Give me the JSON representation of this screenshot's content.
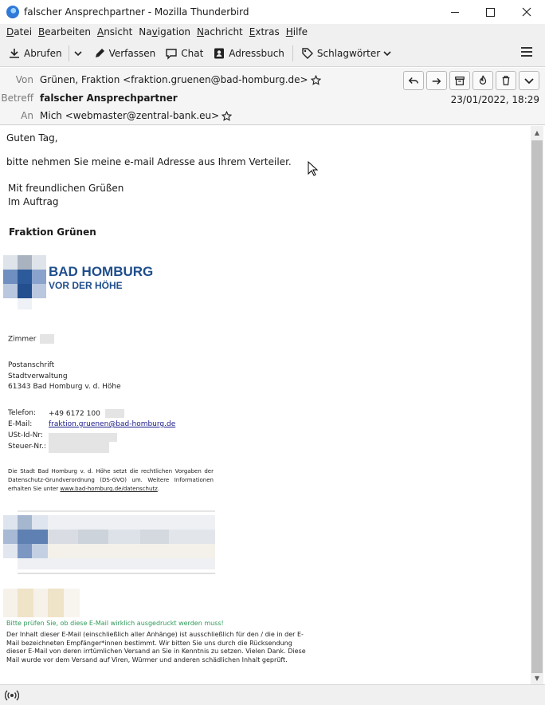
{
  "window": {
    "title": "falscher Ansprechpartner - Mozilla Thunderbird",
    "controls": [
      "minimize",
      "maximize",
      "close"
    ]
  },
  "menubar": {
    "items": [
      {
        "label": "Datei",
        "accel": "D"
      },
      {
        "label": "Bearbeiten",
        "accel": "B"
      },
      {
        "label": "Ansicht",
        "accel": "A"
      },
      {
        "label": "Navigation",
        "accel": "v"
      },
      {
        "label": "Nachricht",
        "accel": "N"
      },
      {
        "label": "Extras",
        "accel": "E"
      },
      {
        "label": "Hilfe",
        "accel": "H"
      }
    ]
  },
  "toolbar": {
    "abrufen": "Abrufen",
    "verfassen": "Verfassen",
    "chat": "Chat",
    "adressbuch": "Adressbuch",
    "schlagwoerter": "Schlagwörter"
  },
  "header": {
    "von_label": "Von",
    "von_value": "Grünen, Fraktion <fraktion.gruenen@bad-homburg.de>",
    "betreff_label": "Betreff",
    "betreff_value": "falscher Ansprechpartner",
    "an_label": "An",
    "an_value": "Mich <webmaster@zentral-bank.eu>",
    "date": "23/01/2022, 18:29"
  },
  "body": {
    "greeting": "Guten Tag,",
    "line1": "bitte nehmen Sie meine e-mail Adresse aus Ihrem Verteiler.",
    "closing1": "Mit freundlichen Grüßen",
    "closing2": "Im Auftrag",
    "sender": "Fraktion Grünen",
    "logo_line1": "BAD HOMBURG",
    "logo_line2": "VOR DER HÖHE",
    "zimmer": "Zimmer",
    "postanschrift": "Postanschrift",
    "stadtverwaltung": "Stadtverwaltung",
    "ort": "61343 Bad Homburg v. d. Höhe",
    "telefon_label": "Telefon:",
    "telefon_value": "+49 6172 100",
    "email_label": "E-Mail:",
    "email_value": "fraktion.gruenen@bad-homburg.de",
    "ust_label": "USt-Id-Nr:",
    "steuer_label": "Steuer-Nr.:",
    "datenschutz_text": "Die Stadt Bad Homburg v. d. Höhe setzt die rechtlichen Vorgaben der Datenschutz-Grundverordnung (DS-GVO) um. Weitere Informationen erhalten Sie unter",
    "datenschutz_link": "www.bad-homburg.de/datenschutz",
    "print_notice": "Bitte prüfen Sie, ob diese E-Mail wirklich ausgedruckt werden muss!",
    "disclaimer": "Der Inhalt dieser E-Mail (einschließlich aller Anhänge) ist ausschließlich für den / die in der E-Mail bezeichneten Empfänger*innen bestimmt. Wir bitten Sie uns durch die Rücksendung dieser E-Mail von deren irrtümlichen Versand an Sie in Kenntnis zu setzen. Vielen Dank. Diese Mail wurde vor dem Versand auf Viren, Würmer und anderen schädlichen Inhalt geprüft."
  },
  "colors": {
    "logo_blue": "#1f4e8c",
    "print_notice_green": "#2e9a5a",
    "link": "#1a1a8a"
  }
}
